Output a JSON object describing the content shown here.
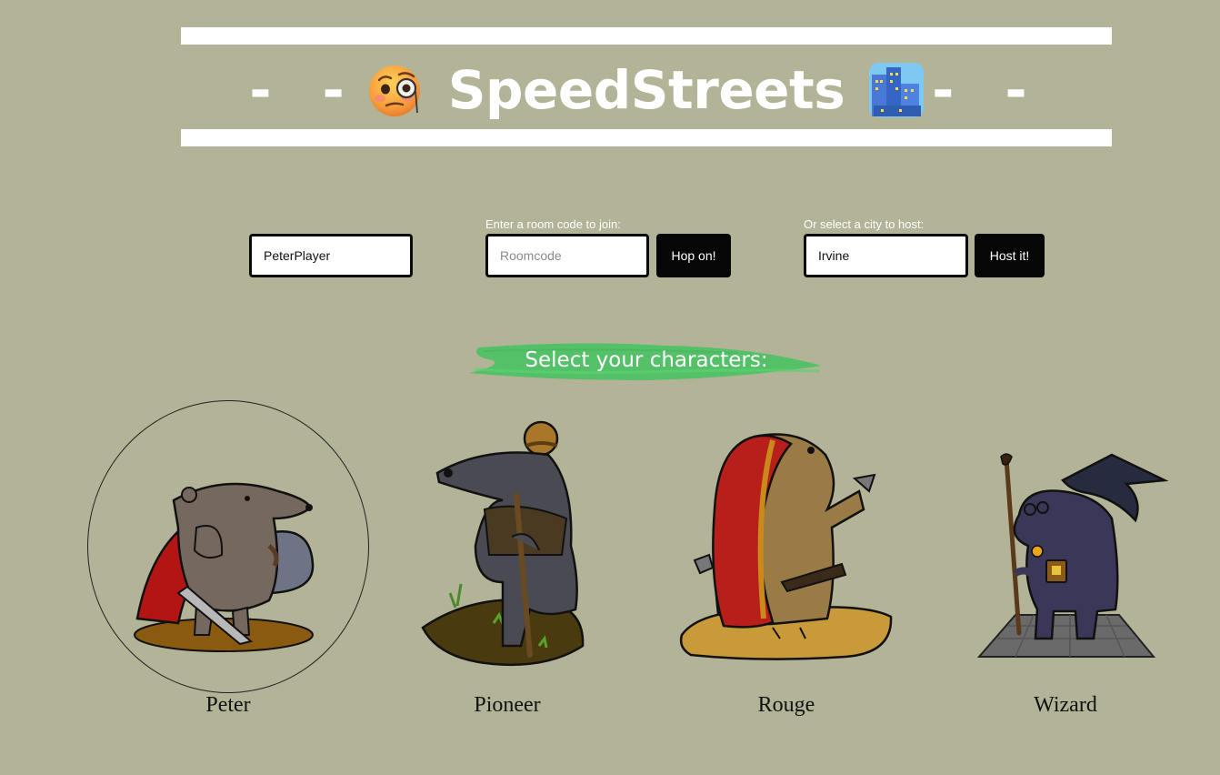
{
  "header": {
    "dash_left": "- -",
    "title": "SpeedStreets",
    "dash_right": "- -",
    "left_icon": "face-with-monocle-icon",
    "right_icon": "cityscape-icon"
  },
  "form": {
    "name_input": {
      "value": "PeterPlayer",
      "placeholder": ""
    },
    "join": {
      "label": "Enter a room code to join:",
      "placeholder": "Roomcode",
      "value": "",
      "button": "Hop on!"
    },
    "host": {
      "label": "Or select a city to host:",
      "value": "Irvine",
      "button": "Host it!"
    }
  },
  "characters_section": {
    "heading": "Select your characters:",
    "brush_color": "#4fc266",
    "characters": [
      {
        "name": "Peter",
        "selected": true
      },
      {
        "name": "Pioneer",
        "selected": false
      },
      {
        "name": "Rouge",
        "selected": false
      },
      {
        "name": "Wizard",
        "selected": false
      }
    ]
  },
  "colors": {
    "background": "#b3b497",
    "button": "#060606",
    "text_light": "#ffffff"
  }
}
